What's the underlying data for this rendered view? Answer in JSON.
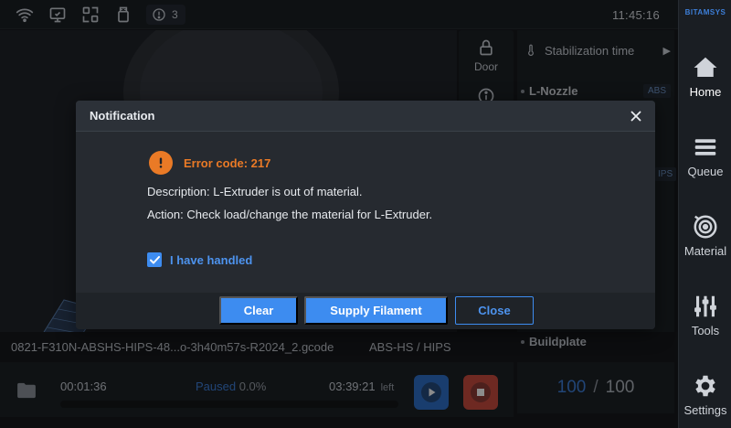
{
  "status_bar": {
    "icons": [
      "wifi-icon",
      "monitor-icon",
      "scan-icon",
      "usb-drive-icon"
    ],
    "notification_count": "3",
    "time": "11:45:16"
  },
  "brand": "BITAMSYS",
  "nav": {
    "items": [
      {
        "label": "Home",
        "icon": "home-icon",
        "active": true
      },
      {
        "label": "Queue",
        "icon": "queue-icon",
        "active": false
      },
      {
        "label": "Material",
        "icon": "material-spool-icon",
        "active": false
      },
      {
        "label": "Tools",
        "icon": "tools-sliders-icon",
        "active": false
      },
      {
        "label": "Settings",
        "icon": "gear-icon",
        "active": false
      }
    ]
  },
  "side": {
    "door_label": "Door"
  },
  "panel": {
    "stabilization_label": "Stabilization time",
    "nozzle_label": "L-Nozzle",
    "nozzle_material": "ABS",
    "second_tag": "IPS",
    "buildplate_label": "Buildplate",
    "buildplate_current": "100",
    "buildplate_separator": "/",
    "buildplate_target": "100"
  },
  "job": {
    "filename": "0821-F310N-ABSHS-HIPS-48...o-3h40m57s-R2024_2.gcode",
    "materials": "ABS-HS / HIPS",
    "elapsed": "00:01:36",
    "state": "Paused",
    "progress": "0.0%",
    "progress_value": 0.0,
    "remaining": "03:39:21",
    "remaining_suffix": "left"
  },
  "dialog": {
    "title": "Notification",
    "error_code": "Error code: 217",
    "description": "Description: L-Extruder is out of material.",
    "action": "Action: Check load/change the material for L-Extruder.",
    "checkbox_label": "I have handled",
    "checkbox_checked": true,
    "buttons": {
      "clear": "Clear",
      "supply": "Supply Filament",
      "close": "Close"
    }
  },
  "colors": {
    "accent": "#3d8cf0",
    "warning": "#ea7a26",
    "stop": "#c94b3e",
    "background": "#16191d"
  }
}
